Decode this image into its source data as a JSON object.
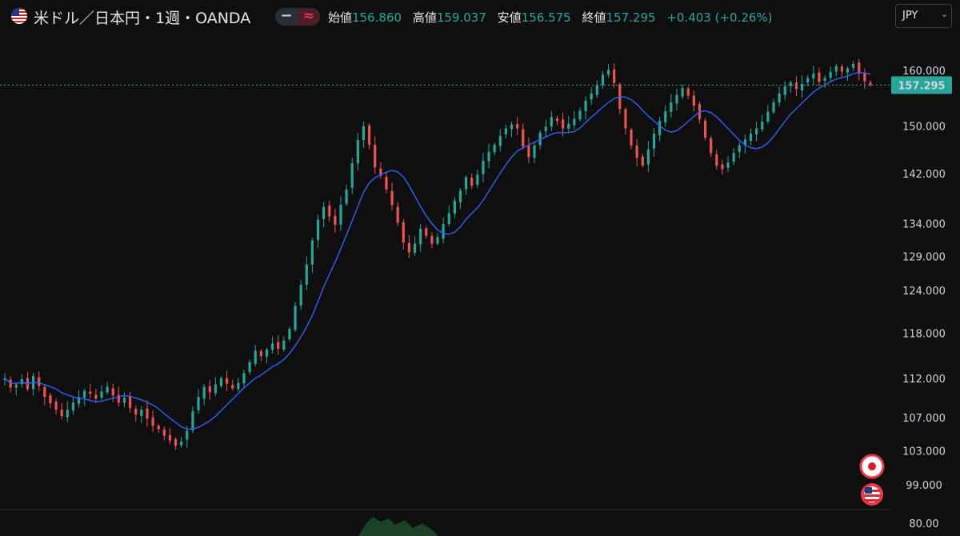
{
  "header": {
    "flag_icon": "us-flag-icon",
    "title": "米ドル／日本円・1週・OANDA",
    "ohlc": {
      "open_label": "始値",
      "open_value": "156.860",
      "high_label": "高値",
      "high_value": "159.037",
      "low_label": "安値",
      "low_value": "156.575",
      "close_label": "終値",
      "close_value": "157.295",
      "change": "+0.403 (+0.26%)"
    },
    "toggle_left_icon": "minus-icon",
    "toggle_right_icon": "wave-icon",
    "currency_button": "JPY"
  },
  "colors": {
    "up": "#26a69a",
    "down": "#ef5350",
    "ma": "#2962ff",
    "last_price_bg": "#26a69a",
    "background": "#0f0f0f"
  },
  "markers": [
    "japan-flag-icon",
    "us-flag-icon"
  ],
  "chart_data": {
    "type": "candlestick",
    "interval": "1 week",
    "scale": "log",
    "y_ticks": [
      "160.000",
      "150.000",
      "142.000",
      "134.000",
      "129.000",
      "124.000",
      "118.000",
      "112.000",
      "107.000",
      "103.000",
      "99.000",
      "80.00"
    ],
    "last_price": "157.295",
    "overlay": "moving average",
    "closes": [
      112.0,
      110.8,
      111.2,
      111.9,
      110.6,
      112.3,
      111.0,
      109.6,
      108.8,
      108.0,
      107.2,
      108.0,
      108.9,
      109.6,
      110.4,
      110.0,
      109.4,
      110.3,
      110.9,
      109.8,
      108.9,
      109.5,
      108.2,
      107.4,
      108.0,
      106.9,
      106.0,
      105.6,
      104.8,
      104.2,
      103.6,
      104.1,
      105.4,
      107.8,
      109.6,
      110.9,
      110.2,
      111.2,
      112.0,
      111.3,
      110.7,
      111.4,
      112.7,
      114.1,
      115.6,
      114.9,
      115.8,
      116.6,
      115.9,
      117.0,
      118.6,
      121.8,
      124.8,
      127.8,
      131.4,
      134.6,
      136.6,
      135.1,
      133.8,
      136.9,
      139.4,
      143.7,
      147.6,
      150.0,
      146.8,
      143.0,
      141.6,
      139.4,
      136.9,
      134.1,
      131.1,
      129.6,
      130.9,
      133.2,
      132.1,
      130.9,
      131.9,
      133.9,
      135.6,
      137.6,
      139.2,
      141.4,
      140.0,
      141.8,
      144.1,
      145.6,
      146.8,
      148.3,
      149.6,
      150.3,
      149.6,
      146.5,
      144.7,
      146.7,
      148.9,
      149.9,
      151.6,
      150.9,
      149.6,
      150.4,
      151.3,
      152.7,
      154.5,
      155.8,
      157.3,
      159.2,
      160.1,
      157.7,
      153.0,
      149.6,
      146.7,
      144.6,
      143.3,
      146.0,
      148.7,
      150.9,
      152.6,
      154.2,
      155.5,
      156.8,
      155.4,
      153.6,
      151.2,
      148.0,
      145.4,
      143.3,
      142.7,
      143.8,
      145.4,
      146.7,
      147.7,
      148.7,
      149.6,
      150.8,
      152.5,
      154.2,
      155.8,
      157.1,
      157.8,
      156.6,
      157.5,
      158.6,
      159.4,
      157.9,
      158.6,
      159.7,
      160.8,
      159.8,
      160.4,
      161.2,
      159.4,
      158.0,
      157.3
    ]
  }
}
